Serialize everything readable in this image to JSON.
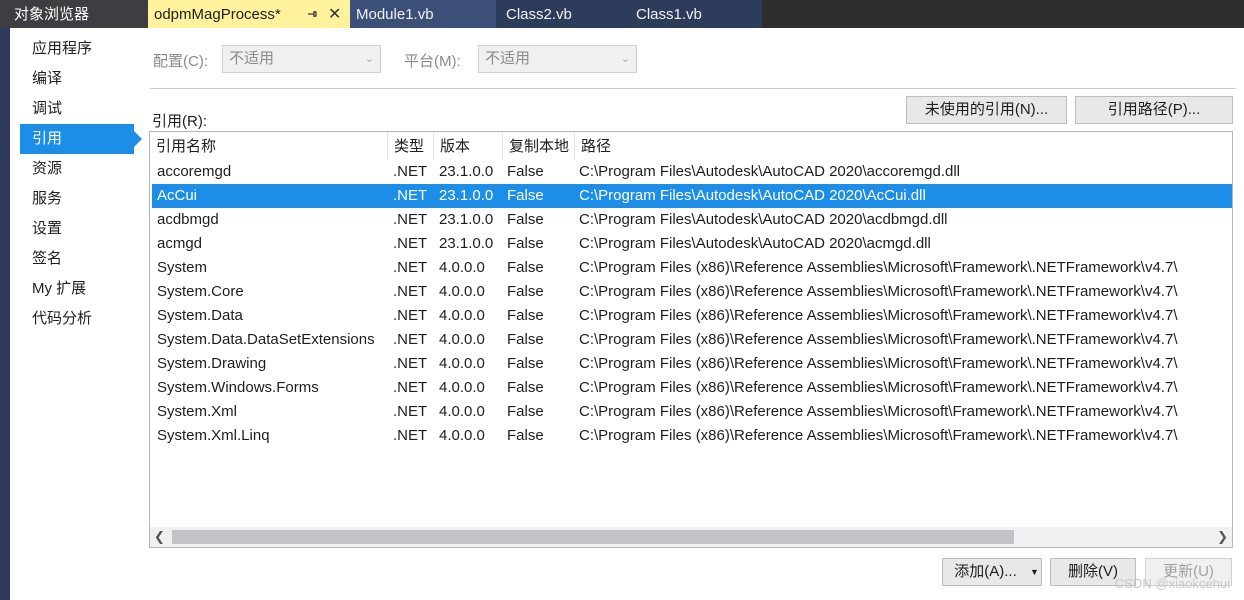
{
  "tabs": {
    "object_browser": "对象浏览器",
    "active": "odpmMagProcess*",
    "pin_icon": "pin-icon",
    "close_glyph": "✕",
    "others": [
      "Module1.vb",
      "Class2.vb",
      "Class1.vb"
    ]
  },
  "nav": {
    "items": [
      "应用程序",
      "编译",
      "调试",
      "引用",
      "资源",
      "服务",
      "设置",
      "签名",
      "My 扩展",
      "代码分析"
    ],
    "selected_index": 3
  },
  "config": {
    "config_label": "配置(C):",
    "config_value": "不适用",
    "platform_label": "平台(M):",
    "platform_value": "不适用"
  },
  "references": {
    "label": "引用(R):",
    "unused_button": "未使用的引用(N)...",
    "paths_button": "引用路径(P)...",
    "columns": [
      "引用名称",
      "类型",
      "版本",
      "复制本地",
      "路径"
    ],
    "rows": [
      {
        "name": "accoremgd",
        "type": ".NET",
        "version": "23.1.0.0",
        "copy": "False",
        "path": "C:\\Program Files\\Autodesk\\AutoCAD 2020\\accoremgd.dll"
      },
      {
        "name": "AcCui",
        "type": ".NET",
        "version": "23.1.0.0",
        "copy": "False",
        "path": "C:\\Program Files\\Autodesk\\AutoCAD 2020\\AcCui.dll"
      },
      {
        "name": "acdbmgd",
        "type": ".NET",
        "version": "23.1.0.0",
        "copy": "False",
        "path": "C:\\Program Files\\Autodesk\\AutoCAD 2020\\acdbmgd.dll"
      },
      {
        "name": "acmgd",
        "type": ".NET",
        "version": "23.1.0.0",
        "copy": "False",
        "path": "C:\\Program Files\\Autodesk\\AutoCAD 2020\\acmgd.dll"
      },
      {
        "name": "System",
        "type": ".NET",
        "version": "4.0.0.0",
        "copy": "False",
        "path": "C:\\Program Files (x86)\\Reference Assemblies\\Microsoft\\Framework\\.NETFramework\\v4.7\\"
      },
      {
        "name": "System.Core",
        "type": ".NET",
        "version": "4.0.0.0",
        "copy": "False",
        "path": "C:\\Program Files (x86)\\Reference Assemblies\\Microsoft\\Framework\\.NETFramework\\v4.7\\"
      },
      {
        "name": "System.Data",
        "type": ".NET",
        "version": "4.0.0.0",
        "copy": "False",
        "path": "C:\\Program Files (x86)\\Reference Assemblies\\Microsoft\\Framework\\.NETFramework\\v4.7\\"
      },
      {
        "name": "System.Data.DataSetExtensions",
        "type": ".NET",
        "version": "4.0.0.0",
        "copy": "False",
        "path": "C:\\Program Files (x86)\\Reference Assemblies\\Microsoft\\Framework\\.NETFramework\\v4.7\\"
      },
      {
        "name": "System.Drawing",
        "type": ".NET",
        "version": "4.0.0.0",
        "copy": "False",
        "path": "C:\\Program Files (x86)\\Reference Assemblies\\Microsoft\\Framework\\.NETFramework\\v4.7\\"
      },
      {
        "name": "System.Windows.Forms",
        "type": ".NET",
        "version": "4.0.0.0",
        "copy": "False",
        "path": "C:\\Program Files (x86)\\Reference Assemblies\\Microsoft\\Framework\\.NETFramework\\v4.7\\"
      },
      {
        "name": "System.Xml",
        "type": ".NET",
        "version": "4.0.0.0",
        "copy": "False",
        "path": "C:\\Program Files (x86)\\Reference Assemblies\\Microsoft\\Framework\\.NETFramework\\v4.7\\"
      },
      {
        "name": "System.Xml.Linq",
        "type": ".NET",
        "version": "4.0.0.0",
        "copy": "False",
        "path": "C:\\Program Files (x86)\\Reference Assemblies\\Microsoft\\Framework\\.NETFramework\\v4.7\\"
      }
    ],
    "selected_row": 1
  },
  "actions": {
    "add": "添加(A)...",
    "remove": "删除(V)",
    "update": "更新(U)"
  },
  "watermark": "CSDN @xiaokcehui",
  "colors": {
    "selection": "#1d8ee8",
    "active_tab": "#fff29d",
    "titlebar": "#2d2d30"
  }
}
